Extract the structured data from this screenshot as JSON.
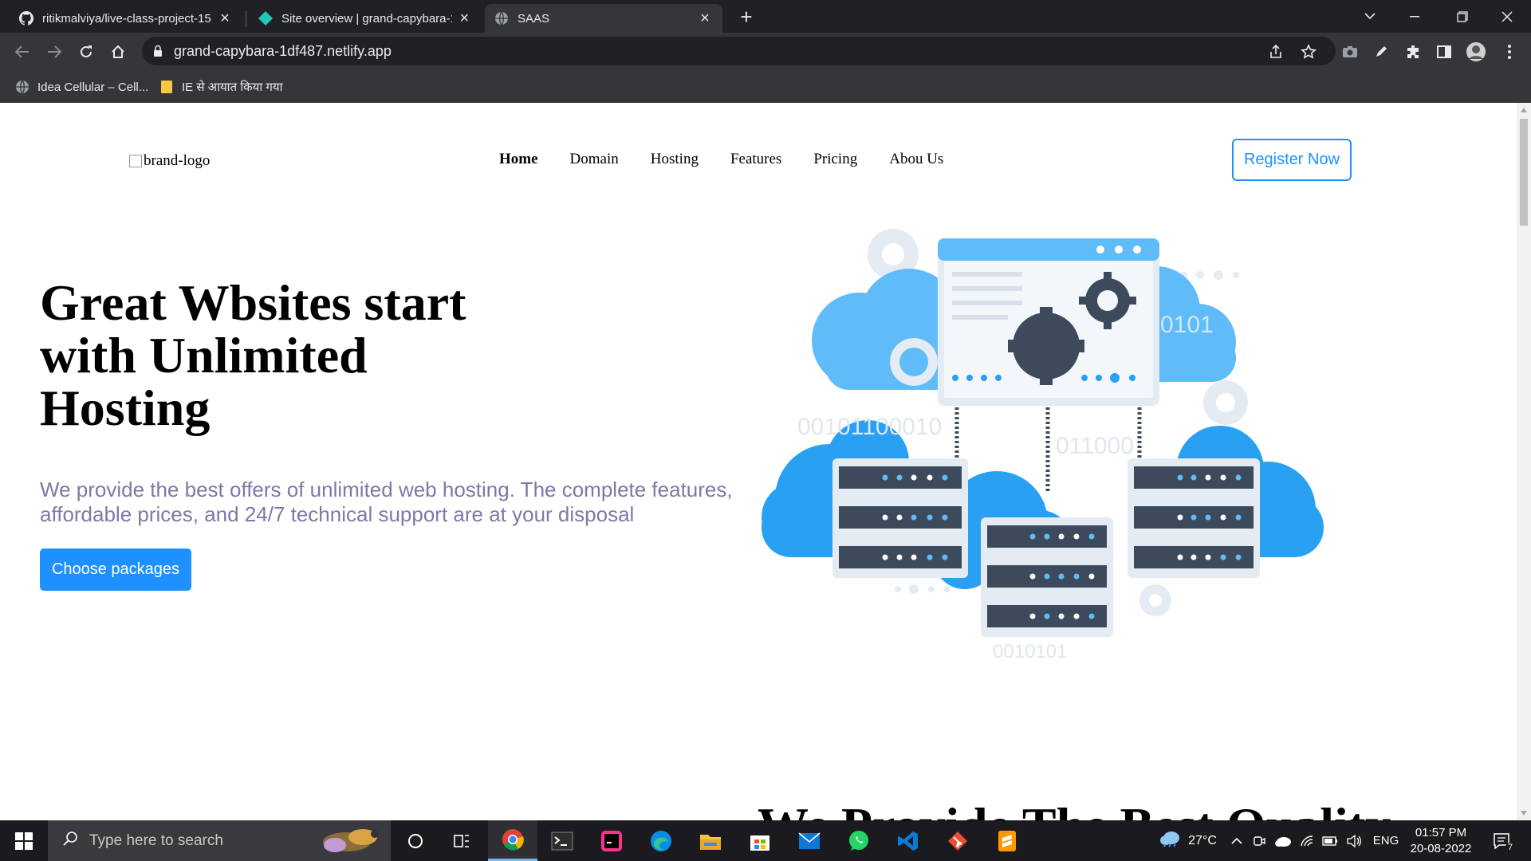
{
  "browser": {
    "tabs": [
      {
        "title": "ritikmalviya/live-class-project-15",
        "icon": "github-icon",
        "active": false
      },
      {
        "title": "Site overview | grand-capybara-1",
        "icon": "netlify-icon",
        "active": false
      },
      {
        "title": "SAAS",
        "icon": "globe-icon",
        "active": true
      }
    ],
    "address": "grand-capybara-1df487.netlify.app",
    "bookmarks": [
      {
        "label": "Idea Cellular – Cell...",
        "icon": "globe-icon"
      },
      {
        "label": "IE से आयात किया गया",
        "icon": "folder-icon"
      }
    ]
  },
  "page": {
    "logo_alt": "brand-logo",
    "nav": [
      "Home",
      "Domain",
      "Hosting",
      "Features",
      "Pricing",
      "Abou Us"
    ],
    "register_label": "Register Now",
    "hero": {
      "title": "Great Wbsites start with Unlimited Hosting",
      "subtitle": "We provide the best offers of unlimited web hosting. The complete features, affordable prices, and 24/7 technical support are at your disposal",
      "cta_label": "Choose packages"
    },
    "illustration": {
      "binary_1": "0101",
      "binary_2": "00101100010",
      "binary_3": "011000",
      "binary_4": "0010101"
    },
    "section2_title": "We Provide The Best Quality"
  },
  "taskbar": {
    "search_placeholder": "Type here to search",
    "weather": "27°C",
    "language": "ENG",
    "time": "01:57 PM",
    "date": "20-08-2022",
    "notifications": "7",
    "apps": [
      "cortana-icon",
      "task-view-icon",
      "chrome-icon",
      "terminal-icon",
      "intellij-icon",
      "edge-icon",
      "file-explorer-icon",
      "store-icon",
      "mail-icon",
      "whatsapp-icon",
      "vscode-icon",
      "git-icon",
      "sublime-icon"
    ]
  },
  "colors": {
    "accent": "#1e90ff",
    "subtitle": "#7d79a8",
    "cloud": "#4cb0f5",
    "server": "#3d4a5c"
  }
}
